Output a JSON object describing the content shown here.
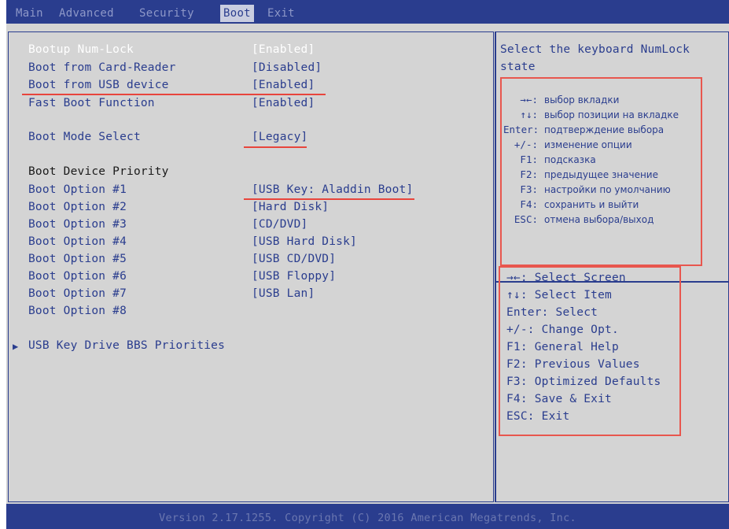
{
  "menu": {
    "tabs": [
      {
        "label": "Main"
      },
      {
        "label": "Advanced"
      },
      {
        "label": "Security"
      },
      {
        "label": "Boot"
      },
      {
        "label": "Exit"
      }
    ],
    "active_tab": "Boot"
  },
  "settings": {
    "numlock": {
      "label": "Bootup Num-Lock",
      "value": "[Enabled]"
    },
    "card_reader": {
      "label": "Boot from Card-Reader",
      "value": "[Disabled]"
    },
    "usb_device": {
      "label": "Boot from USB device",
      "value": "[Enabled]"
    },
    "fast_boot": {
      "label": "Fast Boot Function",
      "value": "[Enabled]"
    },
    "boot_mode": {
      "label": "Boot Mode Select",
      "value": "[Legacy]"
    },
    "priority_heading": "Boot Device Priority",
    "boot_options": [
      {
        "label": "Boot Option #1",
        "value": "[USB Key: Aladdin Boot]"
      },
      {
        "label": "Boot Option #2",
        "value": "[Hard Disk]"
      },
      {
        "label": "Boot Option #3",
        "value": "[CD/DVD]"
      },
      {
        "label": "Boot Option #4",
        "value": "[USB Hard Disk]"
      },
      {
        "label": "Boot Option #5",
        "value": "[USB CD/DVD]"
      },
      {
        "label": "Boot Option #6",
        "value": "[USB Floppy]"
      },
      {
        "label": "Boot Option #7",
        "value": "[USB Lan]"
      },
      {
        "label": "Boot Option #8",
        "value": ""
      }
    ],
    "submenu": "USB Key Drive BBS Priorities"
  },
  "help": {
    "description": "Select the keyboard NumLock state",
    "ru_legend": [
      {
        "key": "→←:",
        "desc": "выбор вкладки"
      },
      {
        "key": "↑↓:",
        "desc": "выбор позиции на вкладке"
      },
      {
        "key": "Enter:",
        "desc": "подтверждение выбора"
      },
      {
        "key": "+/-:",
        "desc": "изменение опции"
      },
      {
        "key": "F1:",
        "desc": "подсказка"
      },
      {
        "key": "F2:",
        "desc": "предыдущее значение"
      },
      {
        "key": "F3:",
        "desc": "настройки по умолчанию"
      },
      {
        "key": "F4:",
        "desc": "сохранить и выйти"
      },
      {
        "key": "ESC:",
        "desc": "отмена выбора/выход"
      }
    ],
    "en_legend": [
      "→←: Select Screen",
      "↑↓: Select Item",
      "Enter: Select",
      "+/-: Change Opt.",
      "F1: General Help",
      "F2: Previous Values",
      "F3: Optimized Defaults",
      "F4: Save & Exit",
      "ESC: Exit"
    ]
  },
  "footer": {
    "text": "Version 2.17.1255. Copyright (C) 2016 American Megatrends, Inc."
  },
  "colors": {
    "bios_blue": "#2a3d8e",
    "panel_gray": "#d4d4d4",
    "annotation_red": "#e8453c"
  }
}
